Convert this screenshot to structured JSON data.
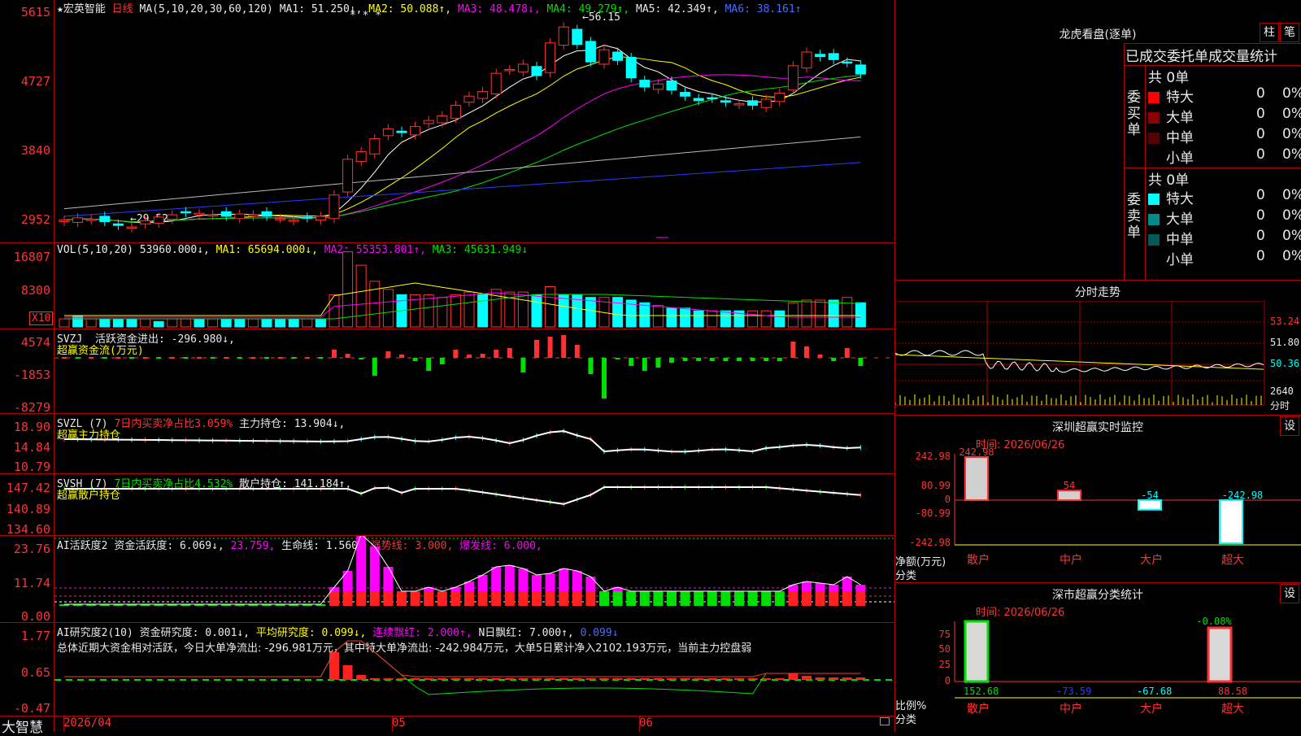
{
  "app": {
    "name": "大智慧"
  },
  "stock": {
    "star": "★",
    "name": "宏英智能",
    "period": "日线"
  },
  "colors": {
    "up": "#ff3232",
    "down": "#00ffff",
    "grid": "#b00000",
    "ma1": "#ffffff",
    "ma2": "#ffff00",
    "ma3": "#ff00ff",
    "ma4": "#00e000",
    "ma5": "#bbbbbb",
    "ma6": "#2a3cff"
  },
  "main": {
    "ma_params": "MA(5,10,20,30,60,120)",
    "ma1": "MA1: 51.250↓,",
    "ma2": "MA2: 50.088↑,",
    "ma3": "MA3: 48.478↓,",
    "ma4": "MA4: 49.279↑,",
    "ma5": "MA5: 42.349↑,",
    "ma6": "MA6: 38.161↑",
    "y_labels": [
      "5615",
      "4727",
      "3840",
      "2952"
    ],
    "high_label": "56.15",
    "low_label": "29.52",
    "markers": "* * *"
  },
  "vol": {
    "title": "VOL(5,10,20)",
    "value": "53960.000↓,",
    "ma1": "MA1: 65694.000↓,",
    "ma2": "MA2: 55353.801↑,",
    "ma3": "MA3: 45631.949↓",
    "y_labels": [
      "16807",
      "8300"
    ],
    "unit": "X10"
  },
  "svzj": {
    "title": "SVZJ",
    "label": "活跃资金进出: -296.980↓,",
    "subtitle": "超赢资金流(万元)",
    "y_labels": [
      "4574",
      "-1853",
      "-8279"
    ]
  },
  "svzl": {
    "title": "SVZL (7)",
    "ratio": "7日内买卖净占比3.059%",
    "hold": "主力持仓: 13.904↓,",
    "subtitle": "超赢主力持仓",
    "y_labels": [
      "18.90",
      "14.84",
      "10.79"
    ]
  },
  "svsh": {
    "title": "SVSH (7)",
    "ratio": "7日内买卖净占比4.532%",
    "hold": "散户持仓: 141.184↑,",
    "subtitle": "超赢散户持仓",
    "y_labels": [
      "147.42",
      "140.89",
      "134.60"
    ]
  },
  "ai1": {
    "title": "AI活跃度2",
    "a": "资金活跃度: 6.069↓,",
    "b": "23.759,",
    "c": "生命线: 1.560,",
    "d": "强势线: 3.000,",
    "e": "爆发线: 6.000,",
    "y_labels": [
      "23.76",
      "11.74",
      "0.00"
    ]
  },
  "ai2": {
    "title": "AI研究度2(10)",
    "a": "资金研究度: 0.001↓,",
    "b": "平均研究度: 0.099↓,",
    "c": "连续飘红: 2.000↑,",
    "d": "N日飘红: 7.000↑,",
    "e": "0.099↓",
    "summary": "总体近期大资金相对活跃，今日大单净流出: -296.981万元，其中特大单净流出: -242.984万元，大单5日累计净入2102.193万元，当前主力控盘弱",
    "y_labels": [
      "1.77",
      "0.65",
      "-0.47"
    ]
  },
  "x_axis": {
    "labels": [
      "2026/04",
      "05",
      "06"
    ]
  },
  "dragon": {
    "title": "龙虎看盘(逐单)",
    "btn1": "柱",
    "btn2": "笔",
    "header": "已成交委托单成交量统计",
    "buy_side": "委买单",
    "sell_side": "委卖单",
    "buy_total": "共 0单",
    "sell_total": "共 0单",
    "buy_rows": [
      {
        "name": "特大",
        "count": "0",
        "pct": "0%",
        "color": "#ff0000"
      },
      {
        "name": "大单",
        "count": "0",
        "pct": "0%",
        "color": "#8b0000"
      },
      {
        "name": "中单",
        "count": "0",
        "pct": "0%",
        "color": "#5a0000"
      },
      {
        "name": "小单",
        "count": "0",
        "pct": "0%",
        "color": "#000000"
      }
    ],
    "sell_rows": [
      {
        "name": "特大",
        "count": "0",
        "pct": "0%",
        "color": "#00ffff"
      },
      {
        "name": "大单",
        "count": "0",
        "pct": "0%",
        "color": "#008b8b"
      },
      {
        "name": "中单",
        "count": "0",
        "pct": "0%",
        "color": "#005a5a"
      },
      {
        "name": "小单",
        "count": "0",
        "pct": "0%",
        "color": "#000000"
      }
    ]
  },
  "intraday": {
    "title": "分时走势",
    "y_labels": [
      "53.24",
      "51.80",
      "50.36",
      "2640"
    ],
    "unit": "分时"
  },
  "monitor": {
    "title": "深圳超赢实时监控",
    "btn": "设",
    "time": "时间: 2026/06/26",
    "y_labels": [
      "242.98",
      "80.99",
      "0",
      "-80.99",
      "-242.98"
    ],
    "ylabel": "净额(万元)",
    "xlabel": "分类",
    "categories": [
      "散户",
      "中户",
      "大户",
      "超大"
    ],
    "values": [
      242.98,
      54,
      -54,
      -242.98
    ],
    "value_labels": [
      "242.98",
      "54",
      "-54",
      "-242.98"
    ]
  },
  "classstats": {
    "title": "深市超赢分类统计",
    "btn": "设",
    "time": "时间: 2026/06/26",
    "y_labels": [
      "75",
      "50",
      "25",
      "0"
    ],
    "ylabel": "比例%",
    "xlabel": "分类",
    "categories": [
      "散户",
      "中户",
      "大户",
      "超大"
    ],
    "values": [
      "152.68",
      "-73.59",
      "-67.68",
      "88.58"
    ],
    "top_label": "-0.08%"
  }
}
